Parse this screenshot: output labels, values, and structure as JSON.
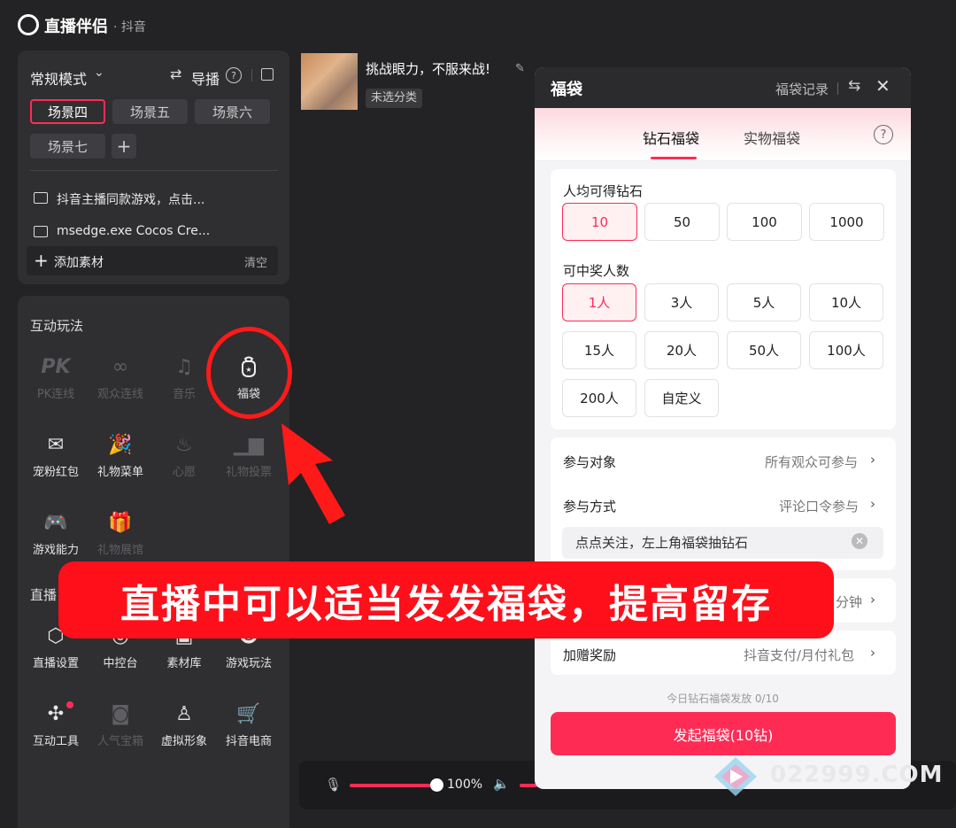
{
  "app": {
    "title": "直播伴侣",
    "subtitle": "· 抖音"
  },
  "scenes_panel": {
    "mode_label": "常规模式",
    "guide_label": "导播",
    "scenes": [
      {
        "label": "场景四",
        "active": true
      },
      {
        "label": "场景五",
        "active": false
      },
      {
        "label": "场景六",
        "active": false
      },
      {
        "label": "场景七",
        "active": false
      }
    ],
    "sources": [
      "抖音主播同款游戏，点击...",
      "msedge.exe Cocos Cre..."
    ],
    "add_source_label": "添加素材",
    "clear_label": "清空"
  },
  "interactive": {
    "section_title": "互动玩法",
    "tools": [
      {
        "label": "PK连线",
        "icon": "pk-icon",
        "enabled": false
      },
      {
        "label": "观众连线",
        "icon": "link-icon",
        "enabled": false
      },
      {
        "label": "音乐",
        "icon": "music-icon",
        "enabled": false
      },
      {
        "label": "福袋",
        "icon": "lucky-bag-icon",
        "enabled": true
      },
      {
        "label": "宠粉红包",
        "icon": "red-packet-icon",
        "enabled": true
      },
      {
        "label": "礼物菜单",
        "icon": "party-icon",
        "enabled": true
      },
      {
        "label": "心愿",
        "icon": "wish-icon",
        "enabled": false
      },
      {
        "label": "礼物投票",
        "icon": "vote-icon",
        "enabled": false
      },
      {
        "label": "游戏能力",
        "icon": "gamepad-icon",
        "enabled": true
      },
      {
        "label": "礼物展馆",
        "icon": "gift-hall-icon",
        "enabled": false
      }
    ]
  },
  "live_tools": {
    "section_title": "直播",
    "tools": [
      {
        "label": "直播设置",
        "icon": "settings-icon",
        "enabled": true
      },
      {
        "label": "中控台",
        "icon": "console-icon",
        "enabled": true
      },
      {
        "label": "素材库",
        "icon": "library-icon",
        "enabled": true
      },
      {
        "label": "游戏玩法",
        "icon": "game-icon",
        "enabled": true
      },
      {
        "label": "互动工具",
        "icon": "puzzle-icon",
        "enabled": true
      },
      {
        "label": "人气宝箱",
        "icon": "treasure-icon",
        "enabled": false
      },
      {
        "label": "虚拟形象",
        "icon": "avatar-icon",
        "enabled": true
      },
      {
        "label": "抖音电商",
        "icon": "cart-icon",
        "enabled": true
      }
    ]
  },
  "stream": {
    "title": "挑战眼力，不服来战!",
    "category": "未选分类"
  },
  "audio": {
    "mic_percent": "100%",
    "mic_level": 1.0
  },
  "lucky_bag": {
    "title": "福袋",
    "record_label": "福袋记录",
    "tabs": [
      "钻石福袋",
      "实物福袋"
    ],
    "diamonds_label": "人均可得钻石",
    "diamond_options": [
      "10",
      "50",
      "100",
      "1000"
    ],
    "winners_label": "可中奖人数",
    "winner_options": [
      "1人",
      "3人",
      "5人",
      "10人",
      "15人",
      "20人",
      "50人",
      "100人",
      "200人",
      "自定义"
    ],
    "participants_label": "参与对象",
    "participants_value": "所有观众可参与",
    "method_label": "参与方式",
    "method_value": "评论口令参与",
    "command_text": "点点关注，左上角福袋抽钻石",
    "duration_value": "分钟",
    "bonus_label": "加赠奖励",
    "bonus_value": "抖音支付/月付礼包",
    "today_stat": "今日钻石福袋发放 0/10",
    "launch_label": "发起福袋(10钻)"
  },
  "overlay": {
    "banner_text": "直播中可以适当发发福袋，提高留存",
    "watermark": "022999.COM"
  },
  "colors": {
    "accent": "#fe2c55",
    "annotation_red": "#ff0f1a"
  }
}
